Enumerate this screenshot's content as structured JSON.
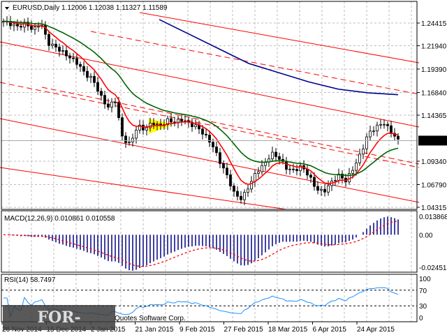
{
  "chart_data": {
    "type": "candlestick",
    "symbol_header": "EURUSD,Daily",
    "ohlc_header": "1.12006 1.12038 1.11327 1.11589",
    "current_price_label": "1.11589",
    "price_ticks": [
      "1.24415",
      "1.21940",
      "1.19390",
      "1.16840",
      "1.14365",
      "1.11589",
      "1.09340",
      "1.06790",
      "1.04315"
    ],
    "price_tick_values": [
      1.24415,
      1.2194,
      1.1939,
      1.1684,
      1.14365,
      1.11589,
      1.0934,
      1.0679,
      1.04315
    ],
    "ylim": [
      1.04315,
      1.24415
    ],
    "date_ticks": [
      "26 Nov 2014",
      "15 Dec 2014",
      "2 Jan 2015",
      "21 Jan 2015",
      "9 Feb 2015",
      "27 Feb 2015",
      "18 Mar 2015",
      "6 Apr 2015",
      "24 Apr 2015"
    ],
    "close_keypoints": [
      1.246,
      1.243,
      1.24,
      1.244,
      1.236,
      1.245,
      1.222,
      1.218,
      1.212,
      1.206,
      1.2,
      1.188,
      1.183,
      1.165,
      1.152,
      1.16,
      1.118,
      1.112,
      1.132,
      1.128,
      1.136,
      1.131,
      1.138,
      1.136,
      1.139,
      1.134,
      1.131,
      1.122,
      1.112,
      1.094,
      1.078,
      1.058,
      1.052,
      1.067,
      1.082,
      1.09,
      1.102,
      1.097,
      1.086,
      1.083,
      1.088,
      1.078,
      1.063,
      1.06,
      1.07,
      1.078,
      1.072,
      1.086,
      1.102,
      1.124,
      1.13,
      1.136,
      1.126,
      1.116
    ],
    "blue_ma_keypoints": [
      1.248,
      1.232,
      1.216,
      1.2,
      1.19,
      1.18,
      1.172,
      1.168,
      1.166
    ],
    "macd_title": "MACD(12,26,9) 0.010861 0.010558",
    "macd_ticks": [
      "0.013868",
      "0.00",
      "-0.024515"
    ],
    "macd_range": [
      -0.024515,
      0.013868
    ],
    "rsi_title": "RSI(14) 58.7497",
    "rsi_ticks": [
      "100",
      "70",
      "30",
      "0"
    ],
    "rsi_levels": [
      70,
      30
    ],
    "colors": {
      "fast_ma": "#ff0000",
      "slow_ma": "#006400",
      "long_ma": "#00008b",
      "channel": "#ff0000",
      "macd": "#000080",
      "rsi": "#1e90ff",
      "candles": "#000000",
      "triangle": "#ffff00"
    }
  },
  "watermark": "FOR-TRADER.RU",
  "copyright": "Quotes Software Corp."
}
